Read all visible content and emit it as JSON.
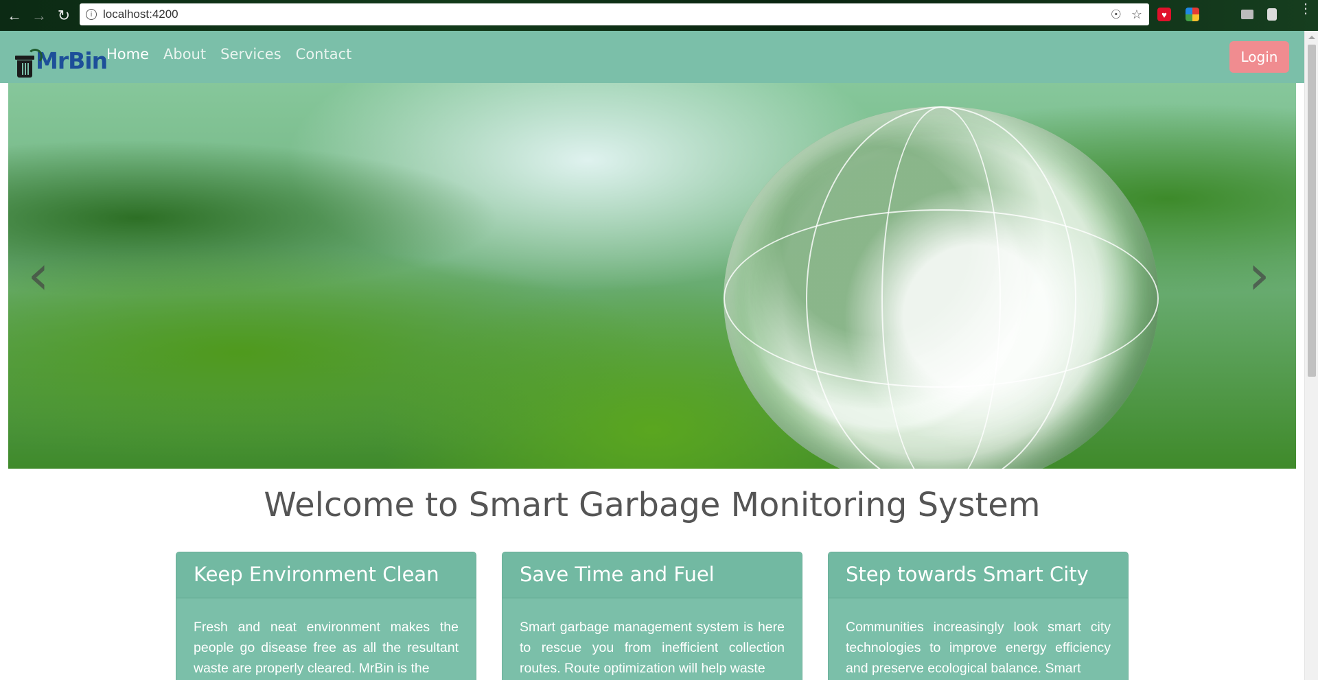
{
  "browser": {
    "url": "localhost:4200",
    "back_icon": "arrow-left-icon",
    "forward_icon": "arrow-right-icon",
    "reload_icon": "reload-icon"
  },
  "navbar": {
    "brand": "MrBin",
    "links": [
      "Home",
      "About",
      "Services",
      "Contact"
    ],
    "login": "Login",
    "color": "#7bbfa9",
    "login_color": "#f08c90"
  },
  "carousel": {
    "prev_icon": "chevron-left-icon",
    "next_icon": "chevron-right-icon"
  },
  "heading": "Welcome to Smart Garbage Monitoring System",
  "cards": [
    {
      "title": "Keep Environment Clean",
      "body": "Fresh and neat environment makes the people go disease free as all the resultant waste are properly cleared. MrBin is the"
    },
    {
      "title": "Save Time and Fuel",
      "body": "Smart garbage management system is here to rescue you from inefficient collection routes. Route optimization will help waste"
    },
    {
      "title": "Step towards Smart City",
      "body": "Communities increasingly look smart city technologies to improve energy efficiency and preserve ecological balance. Smart"
    }
  ]
}
